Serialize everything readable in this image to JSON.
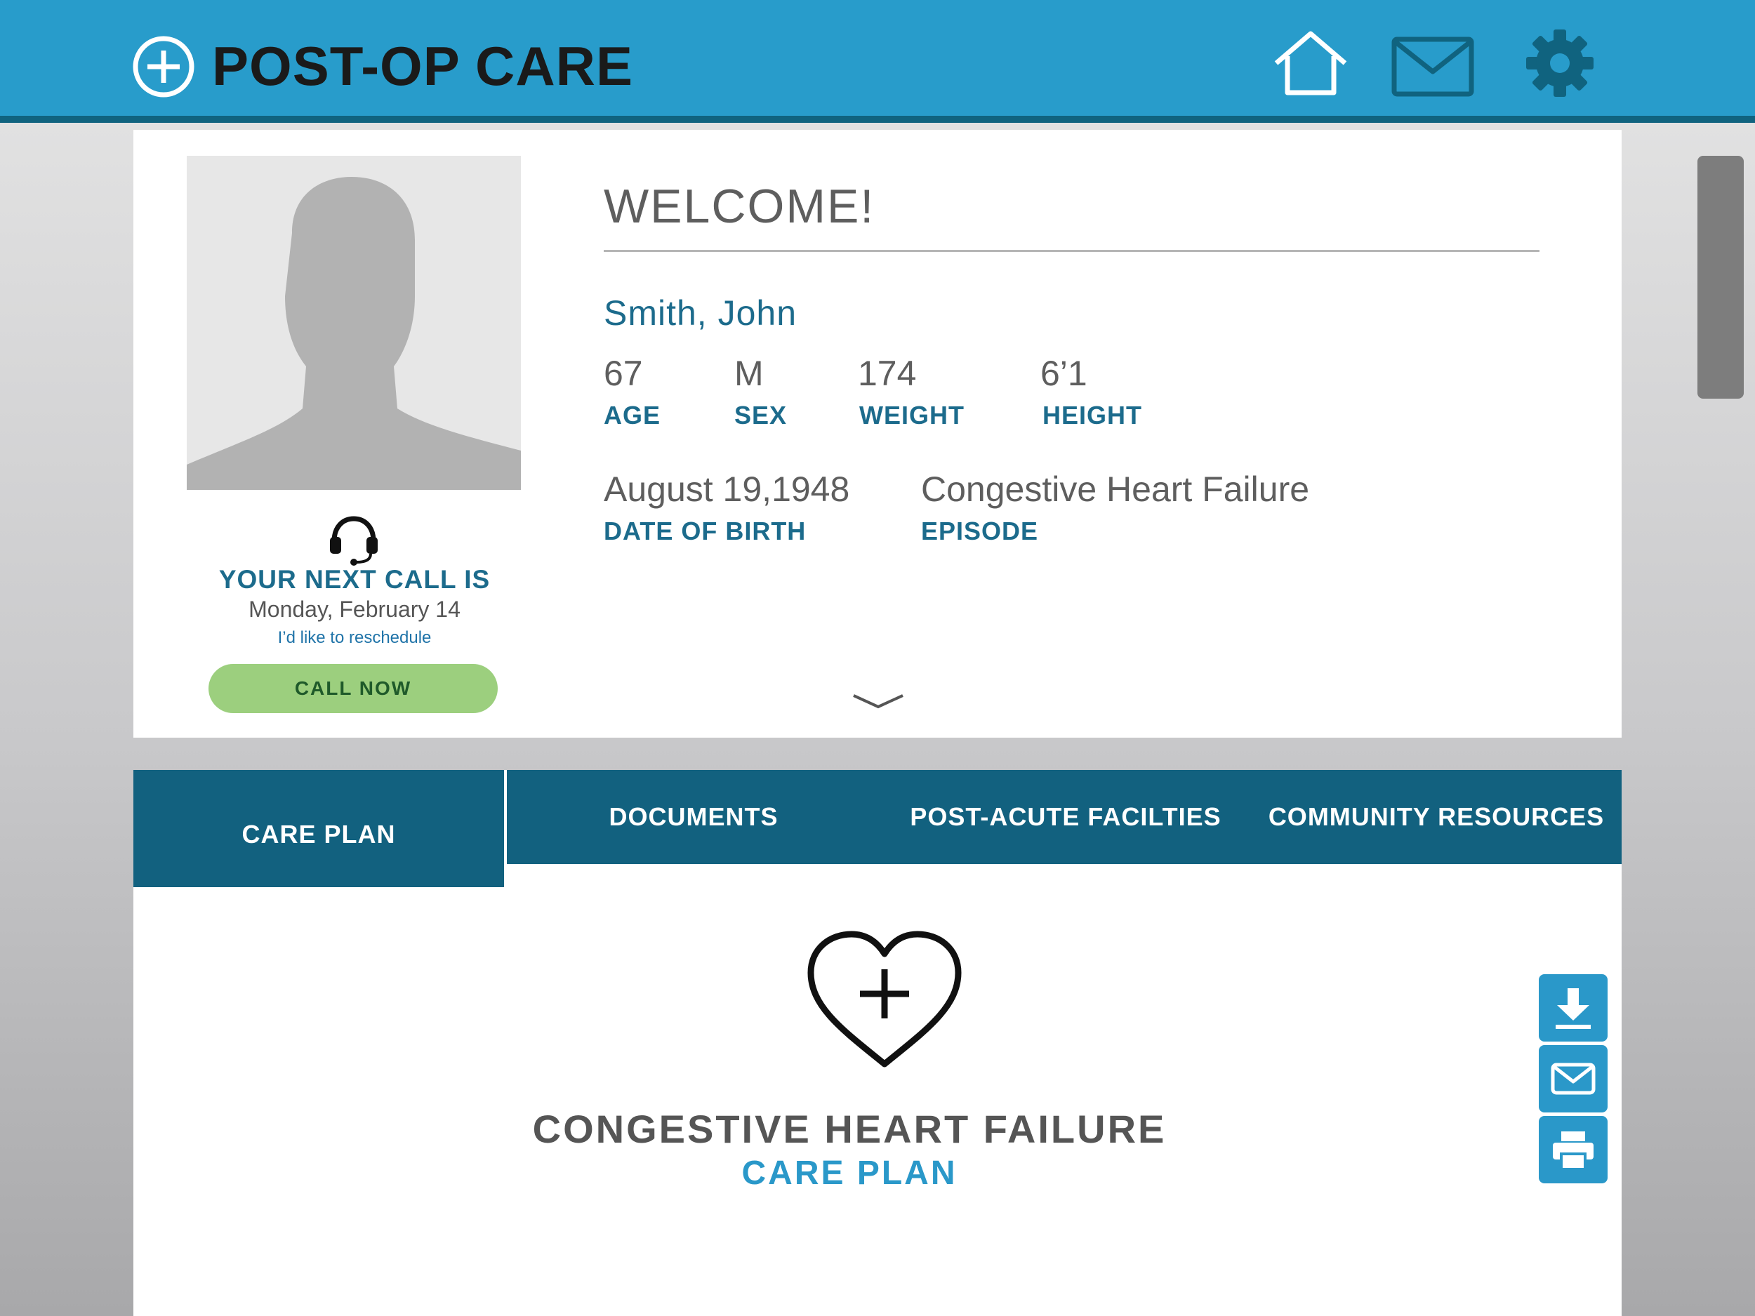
{
  "app": {
    "title": "POST-OP CARE"
  },
  "header": {
    "icons": [
      "plus-circle-icon",
      "home-icon",
      "mail-icon",
      "gear-icon"
    ]
  },
  "profile": {
    "welcome": "WELCOME!",
    "name": "Smith, John",
    "stats": [
      {
        "value": "67",
        "label": "AGE"
      },
      {
        "value": "M",
        "label": "SEX"
      },
      {
        "value": "174",
        "label": "WEIGHT"
      },
      {
        "value": "6’1",
        "label": "HEIGHT"
      }
    ],
    "dob": {
      "value": "August 19,1948",
      "label": "DATE OF BIRTH"
    },
    "episode": {
      "value": "Congestive Heart Failure",
      "label": "EPISODE"
    }
  },
  "call": {
    "label": "YOUR NEXT CALL IS",
    "date": "Monday,  February 14",
    "reschedule": "I’d like to reschedule",
    "button": "CALL NOW"
  },
  "tabs": [
    {
      "label": "CARE PLAN",
      "active": true
    },
    {
      "label": "DOCUMENTS",
      "active": false
    },
    {
      "label": "POST-ACUTE FACILTIES",
      "active": false
    },
    {
      "label": "COMMUNITY RESOURCES",
      "active": false
    }
  ],
  "care_plan": {
    "title": "CONGESTIVE HEART FAILURE",
    "subtitle": "CARE PLAN",
    "actions": [
      "download-icon",
      "mail-icon",
      "print-icon"
    ]
  },
  "colors": {
    "header": "#289ccb",
    "header_border": "#10637f",
    "tabs": "#12617f",
    "accent_text": "#1c6b8c",
    "call_button": "#9ccf7e",
    "action_buttons": "#2a98c9"
  }
}
